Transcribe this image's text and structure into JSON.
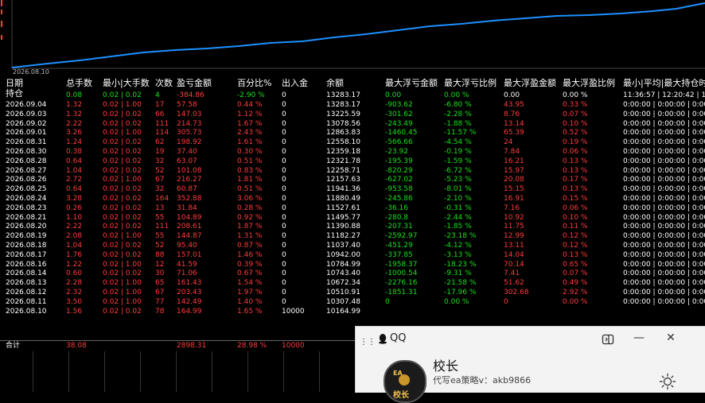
{
  "chart": {
    "x_axis_label": "2026.08.10",
    "line_color": "#1e90ff"
  },
  "table": {
    "headers": {
      "date": "日期",
      "hold": "持仓",
      "total_lots": "总手数",
      "min_max_lots": "最小|大手数",
      "count": "次数",
      "pl": "盈亏金额",
      "pct": "百分比%",
      "inout": "出入金",
      "balance": "余额",
      "max_float_loss": "最大浮亏金额",
      "max_float_loss_pct": "最大浮亏比例",
      "max_float_profit": "最大浮盈金额",
      "max_float_profit_pct": "最大浮盈比例",
      "min_avg_hold": "最小|平均|最大持仓时"
    },
    "hold_row": {
      "total_lots": "0.08",
      "min_max_lots": "0.02 | 0.02",
      "count": "4",
      "pl": "-384.86",
      "pct": "-2.90 %",
      "inout": "0",
      "balance": "13283.17",
      "max_float_loss": "0.00",
      "max_float_loss_pct": "0.00 %",
      "max_float_profit": "0.00",
      "max_float_profit_pct": "0.00 %",
      "time": "11:36:57 | 12:20:42 | 1"
    },
    "rows": [
      {
        "date": "2026.09.04",
        "total": "1.32",
        "lots": "0.02 | 1.00",
        "cnt": "17",
        "pl": "57.58",
        "pct": "0.44 %",
        "io": "0",
        "bal": "13283.17",
        "mfl": "-903.62",
        "mflp": "-6.80 %",
        "mfp": "43.95",
        "mfpp": "0.33 %",
        "time": "0:00:00 | 0:00:00 | 0:00:"
      },
      {
        "date": "2026.09.03",
        "total": "1.32",
        "lots": "0.02 | 0.02",
        "cnt": "66",
        "pl": "147.03",
        "pct": "1.12 %",
        "io": "0",
        "bal": "13225.59",
        "mfl": "-301.62",
        "mflp": "-2.28 %",
        "mfp": "8.76",
        "mfpp": "0.07 %",
        "time": "0:00:00 | 0:00:00 | 0:00:"
      },
      {
        "date": "2026.09.02",
        "total": "2.22",
        "lots": "0.02 | 0.02",
        "cnt": "111",
        "pl": "214.73",
        "pct": "1.67 %",
        "io": "0",
        "bal": "13078.56",
        "mfl": "-243.49",
        "mflp": "-1.88 %",
        "mfp": "13.14",
        "mfpp": "0.10 %",
        "time": "0:00:00 | 0:00:00 | 0:00:"
      },
      {
        "date": "2026.09.01",
        "total": "3.26",
        "lots": "0.02 | 1.00",
        "cnt": "114",
        "pl": "305.73",
        "pct": "2.43 %",
        "io": "0",
        "bal": "12863.83",
        "mfl": "-1460.45",
        "mflp": "-11.57 %",
        "mfp": "65.39",
        "mfpp": "0.52 %",
        "time": "0:00:00 | 0:00:00 | 0:00:"
      },
      {
        "date": "2026.08.31",
        "total": "1.24",
        "lots": "0.02 | 0.02",
        "cnt": "62",
        "pl": "198.92",
        "pct": "1.61 %",
        "io": "0",
        "bal": "12558.10",
        "mfl": "-566.66",
        "mflp": "-4.54 %",
        "mfp": "24",
        "mfpp": "0.19 %",
        "time": "0:00:00 | 0:00:00 | 0:00:"
      },
      {
        "date": "2026.08.30",
        "total": "0.38",
        "lots": "0.02 | 0.02",
        "cnt": "19",
        "pl": "37.40",
        "pct": "0.30 %",
        "io": "0",
        "bal": "12359.18",
        "mfl": "-23.92",
        "mflp": "-0.19 %",
        "mfp": "7.84",
        "mfpp": "0.06 %",
        "time": "0:00:00 | 0:00:00 | 0:00:"
      },
      {
        "date": "2026.08.28",
        "total": "0.64",
        "lots": "0.02 | 0.02",
        "cnt": "32",
        "pl": "63.07",
        "pct": "0.51 %",
        "io": "0",
        "bal": "12321.78",
        "mfl": "-195.39",
        "mflp": "-1.59 %",
        "mfp": "16.21",
        "mfpp": "0.13 %",
        "time": "0:00:00 | 0:00:00 | 0:00:"
      },
      {
        "date": "2026.08.27",
        "total": "1.04",
        "lots": "0.02 | 0.02",
        "cnt": "52",
        "pl": "101.08",
        "pct": "0.83 %",
        "io": "0",
        "bal": "12258.71",
        "mfl": "-820.29",
        "mflp": "-6.72 %",
        "mfp": "15.97",
        "mfpp": "0.13 %",
        "time": "0:00:00 | 0:00:00 | 0:00:"
      },
      {
        "date": "2026.08.26",
        "total": "2.72",
        "lots": "0.02 | 1.00",
        "cnt": "67",
        "pl": "216.27",
        "pct": "1.81 %",
        "io": "0",
        "bal": "12157.63",
        "mfl": "-627.02",
        "mflp": "-5.23 %",
        "mfp": "20.08",
        "mfpp": "0.17 %",
        "time": "0:00:00 | 0:00:00 | 0:00:"
      },
      {
        "date": "2026.08.25",
        "total": "0.64",
        "lots": "0.02 | 0.02",
        "cnt": "32",
        "pl": "60.87",
        "pct": "0.51 %",
        "io": "0",
        "bal": "11941.36",
        "mfl": "-953.58",
        "mflp": "-8.01 %",
        "mfp": "15.15",
        "mfpp": "0.13 %",
        "time": "0:00:00 | 0:00:00 | 0:00:"
      },
      {
        "date": "2026.08.24",
        "total": "3.28",
        "lots": "0.02 | 0.02",
        "cnt": "164",
        "pl": "352.88",
        "pct": "3.06 %",
        "io": "0",
        "bal": "11880.49",
        "mfl": "-245.86",
        "mflp": "-2.10 %",
        "mfp": "16.91",
        "mfpp": "0.15 %",
        "time": "0:00:00 | 0:00:00 | 0:00:"
      },
      {
        "date": "2026.08.23",
        "total": "0.26",
        "lots": "0.02 | 0.02",
        "cnt": "13",
        "pl": "31.84",
        "pct": "0.28 %",
        "io": "0",
        "bal": "11527.61",
        "mfl": "-36.16",
        "mflp": "-0.31 %",
        "mfp": "7.16",
        "mfpp": "0.06 %",
        "time": "0:00:00 | 0:00:00 | 0:00:"
      },
      {
        "date": "2026.08.21",
        "total": "1.10",
        "lots": "0.02 | 0.02",
        "cnt": "55",
        "pl": "104.89",
        "pct": "0.92 %",
        "io": "0",
        "bal": "11495.77",
        "mfl": "-280.8",
        "mflp": "-2.44 %",
        "mfp": "10.92",
        "mfpp": "0.10 %",
        "time": "0:00:00 | 0:00:00 | 0:00:"
      },
      {
        "date": "2026.08.20",
        "total": "2.22",
        "lots": "0.02 | 0.02",
        "cnt": "111",
        "pl": "208.61",
        "pct": "1.87 %",
        "io": "0",
        "bal": "11390.88",
        "mfl": "-207.31",
        "mflp": "-1.85 %",
        "mfp": "11.75",
        "mfpp": "0.11 %",
        "time": "0:00:00 | 0:00:00 | 0:00:"
      },
      {
        "date": "2026.08.19",
        "total": "2.08",
        "lots": "0.02 | 1.00",
        "cnt": "55",
        "pl": "144.87",
        "pct": "1.31 %",
        "io": "0",
        "bal": "11182.27",
        "mfl": "-2592.97",
        "mflp": "-23.18 %",
        "mfp": "12.99",
        "mfpp": "0.12 %",
        "time": "0:00:00 | 0:00:00 | 0:00:"
      },
      {
        "date": "2026.08.18",
        "total": "1.04",
        "lots": "0.02 | 0.02",
        "cnt": "52",
        "pl": "95.40",
        "pct": "0.87 %",
        "io": "0",
        "bal": "11037.40",
        "mfl": "-451.29",
        "mflp": "-4.12 %",
        "mfp": "13.11",
        "mfpp": "0.12 %",
        "time": "0:00:00 | 0:00:00 | 0:00:"
      },
      {
        "date": "2026.08.17",
        "total": "1.76",
        "lots": "0.02 | 0.02",
        "cnt": "88",
        "pl": "157.01",
        "pct": "1.46 %",
        "io": "0",
        "bal": "10942.00",
        "mfl": "-337.85",
        "mflp": "-3.13 %",
        "mfp": "14.04",
        "mfpp": "0.13 %",
        "time": "0:00:00 | 0:00:00 | 0:00:"
      },
      {
        "date": "2026.08.16",
        "total": "1.22",
        "lots": "0.02 | 1.00",
        "cnt": "12",
        "pl": "41.59",
        "pct": "0.39 %",
        "io": "0",
        "bal": "10784.99",
        "mfl": "-1958.37",
        "mflp": "-18.23 %",
        "mfp": "70.14",
        "mfpp": "0.65 %",
        "time": "0:00:00 | 0:00:00 | 0:00:"
      },
      {
        "date": "2026.08.14",
        "total": "0.60",
        "lots": "0.02 | 0.02",
        "cnt": "30",
        "pl": "71.06",
        "pct": "0.67 %",
        "io": "0",
        "bal": "10743.40",
        "mfl": "-1000.54",
        "mflp": "-9.31 %",
        "mfp": "7.41",
        "mfpp": "0.07 %",
        "time": "0:00:00 | 0:00:00 | 0:00:"
      },
      {
        "date": "2026.08.13",
        "total": "2.28",
        "lots": "0.02 | 1.00",
        "cnt": "65",
        "pl": "161.43",
        "pct": "1.54 %",
        "io": "0",
        "bal": "10672.34",
        "mfl": "-2276.16",
        "mflp": "-21.58 %",
        "mfp": "51.62",
        "mfpp": "0.49 %",
        "time": "0:00:00 | 0:00:00 | 0:00:"
      },
      {
        "date": "2026.08.12",
        "total": "2.32",
        "lots": "0.02 | 1.00",
        "cnt": "67",
        "pl": "203.43",
        "pct": "1.97 %",
        "io": "0",
        "bal": "10510.91",
        "mfl": "-1851.31",
        "mflp": "-17.96 %",
        "mfp": "302.68",
        "mfpp": "2.92 %",
        "time": "0:00:00 | 0:00:00 | 0:00:"
      },
      {
        "date": "2026.08.11",
        "total": "3.50",
        "lots": "0.02 | 1.00",
        "cnt": "77",
        "pl": "142.49",
        "pct": "1.40 %",
        "io": "0",
        "bal": "10307.48",
        "mfl": "0",
        "mflp": "0.00 %",
        "mfp": "0",
        "mfpp": "0.00 %",
        "time": "0:00:00 | 0:00:00 | 0:00:"
      },
      {
        "date": "2026.08.10",
        "total": "1.56",
        "lots": "0.02 | 0.02",
        "cnt": "78",
        "pl": "164.99",
        "pct": "1.65 %",
        "io": "10000",
        "bal": "10164.99",
        "mfl": "",
        "mflp": "",
        "mfp": "",
        "mfpp": "",
        "time": ""
      }
    ],
    "total_row": {
      "label": "合计",
      "total": "38.08",
      "pl": "2898.31",
      "pct": "28.98 %",
      "io": "10000"
    }
  },
  "qq_popup": {
    "app_name": "QQ",
    "contact_name": "校长",
    "description": "代写ea策略v：akb9866",
    "menu_dots": "⋮⋮",
    "minimize": "—",
    "close": "✕",
    "avatar_text_top": "EA",
    "avatar_text_bottom": "校长"
  }
}
